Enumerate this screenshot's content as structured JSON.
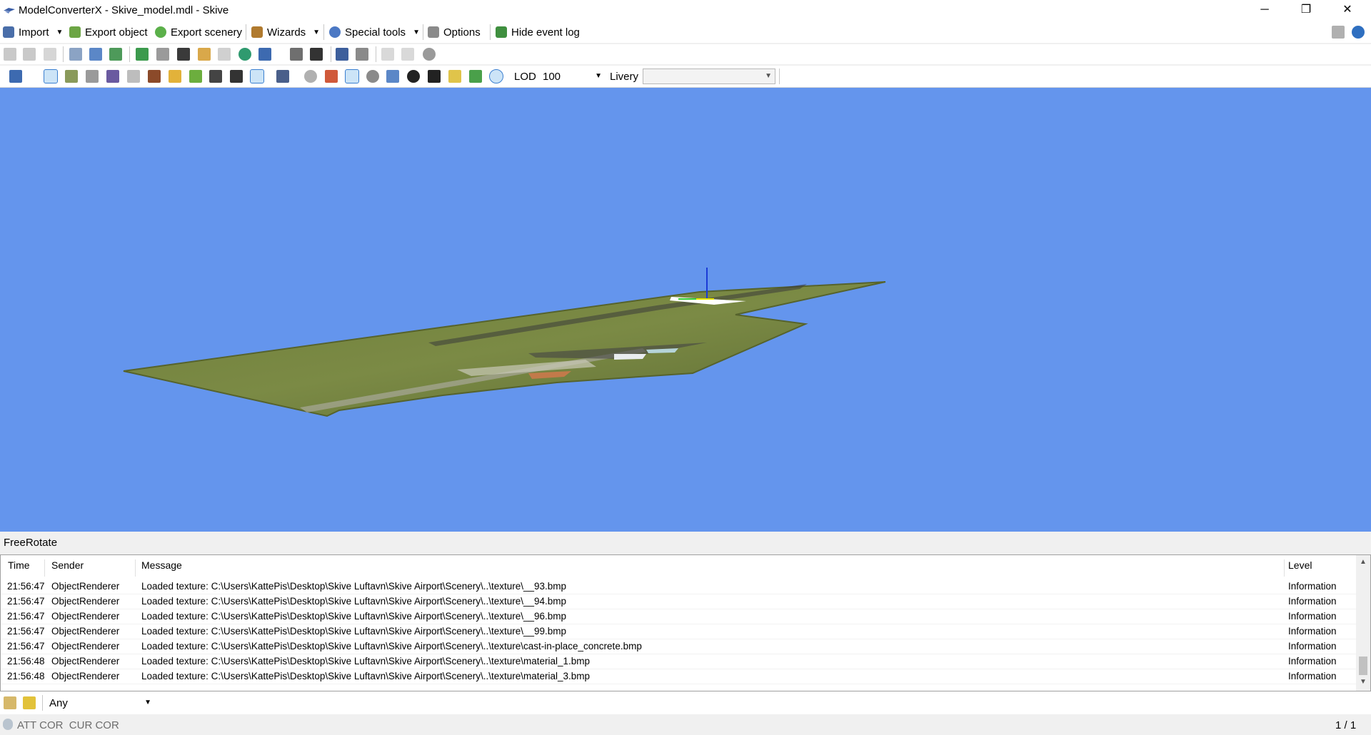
{
  "window": {
    "title": "ModelConverterX - Skive_model.mdl - Skive",
    "minimize_glyph": "─",
    "restore_glyph": "❐",
    "close_glyph": "✕"
  },
  "menubar": {
    "import": "Import",
    "export_object": "Export object",
    "export_scenery": "Export scenery",
    "wizards": "Wizards",
    "special_tools": "Special tools",
    "options": "Options",
    "hide_event_log": "Hide event log"
  },
  "render_toolbar": {
    "lod_label": "LOD",
    "lod_value": "100",
    "livery_label": "Livery",
    "livery_value": ""
  },
  "viewport": {
    "background_color": "#6495ed",
    "mode": "FreeRotate"
  },
  "event_log": {
    "columns": {
      "time": "Time",
      "sender": "Sender",
      "message": "Message",
      "level": "Level"
    },
    "rows": [
      {
        "time": "21:56:47",
        "sender": "ObjectRenderer",
        "message": "Loaded texture: C:\\Users\\KattePis\\Desktop\\Skive Luftavn\\Skive Airport\\Scenery\\..\\texture\\__93.bmp",
        "level": "Information"
      },
      {
        "time": "21:56:47",
        "sender": "ObjectRenderer",
        "message": "Loaded texture: C:\\Users\\KattePis\\Desktop\\Skive Luftavn\\Skive Airport\\Scenery\\..\\texture\\__94.bmp",
        "level": "Information"
      },
      {
        "time": "21:56:47",
        "sender": "ObjectRenderer",
        "message": "Loaded texture: C:\\Users\\KattePis\\Desktop\\Skive Luftavn\\Skive Airport\\Scenery\\..\\texture\\__96.bmp",
        "level": "Information"
      },
      {
        "time": "21:56:47",
        "sender": "ObjectRenderer",
        "message": "Loaded texture: C:\\Users\\KattePis\\Desktop\\Skive Luftavn\\Skive Airport\\Scenery\\..\\texture\\__99.bmp",
        "level": "Information"
      },
      {
        "time": "21:56:47",
        "sender": "ObjectRenderer",
        "message": "Loaded texture: C:\\Users\\KattePis\\Desktop\\Skive Luftavn\\Skive Airport\\Scenery\\..\\texture\\cast-in-place_concrete.bmp",
        "level": "Information"
      },
      {
        "time": "21:56:48",
        "sender": "ObjectRenderer",
        "message": "Loaded texture: C:\\Users\\KattePis\\Desktop\\Skive Luftavn\\Skive Airport\\Scenery\\..\\texture\\material_1.bmp",
        "level": "Information"
      },
      {
        "time": "21:56:48",
        "sender": "ObjectRenderer",
        "message": "Loaded texture: C:\\Users\\KattePis\\Desktop\\Skive Luftavn\\Skive Airport\\Scenery\\..\\texture\\material_3.bmp",
        "level": "Information"
      }
    ],
    "filter_value": "Any"
  },
  "statusbar": {
    "left_text": "ATT COR  CUR COR",
    "page": "1 / 1"
  }
}
